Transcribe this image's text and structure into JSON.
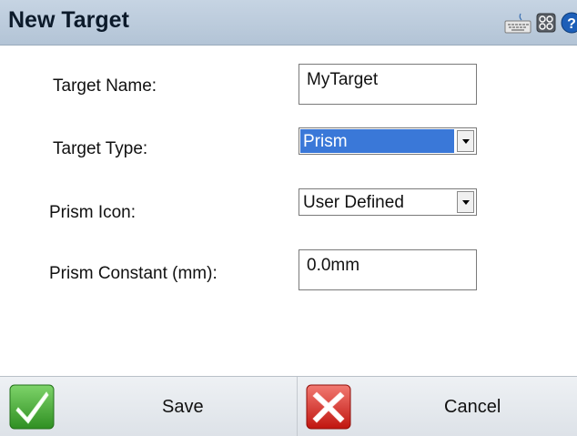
{
  "window": {
    "title": "New Target",
    "icons": [
      "keyboard-icon",
      "settings-icon",
      "help-icon"
    ]
  },
  "form": {
    "target_name": {
      "label": "Target Name:",
      "value": "MyTarget"
    },
    "target_type": {
      "label": "Target Type:",
      "value": "Prism"
    },
    "prism_icon": {
      "label": "Prism Icon:",
      "value": "User Defined"
    },
    "prism_constant": {
      "label": "Prism Constant (mm):",
      "value": "0.0mm"
    }
  },
  "buttons": {
    "save": {
      "label": "Save",
      "icon": "checkmark-icon"
    },
    "cancel": {
      "label": "Cancel",
      "icon": "x-icon"
    }
  },
  "colors": {
    "titlebar": "#b9c9da",
    "selection": "#3a78d8",
    "save_icon": "#3aa52c",
    "cancel_icon": "#d8261e"
  }
}
